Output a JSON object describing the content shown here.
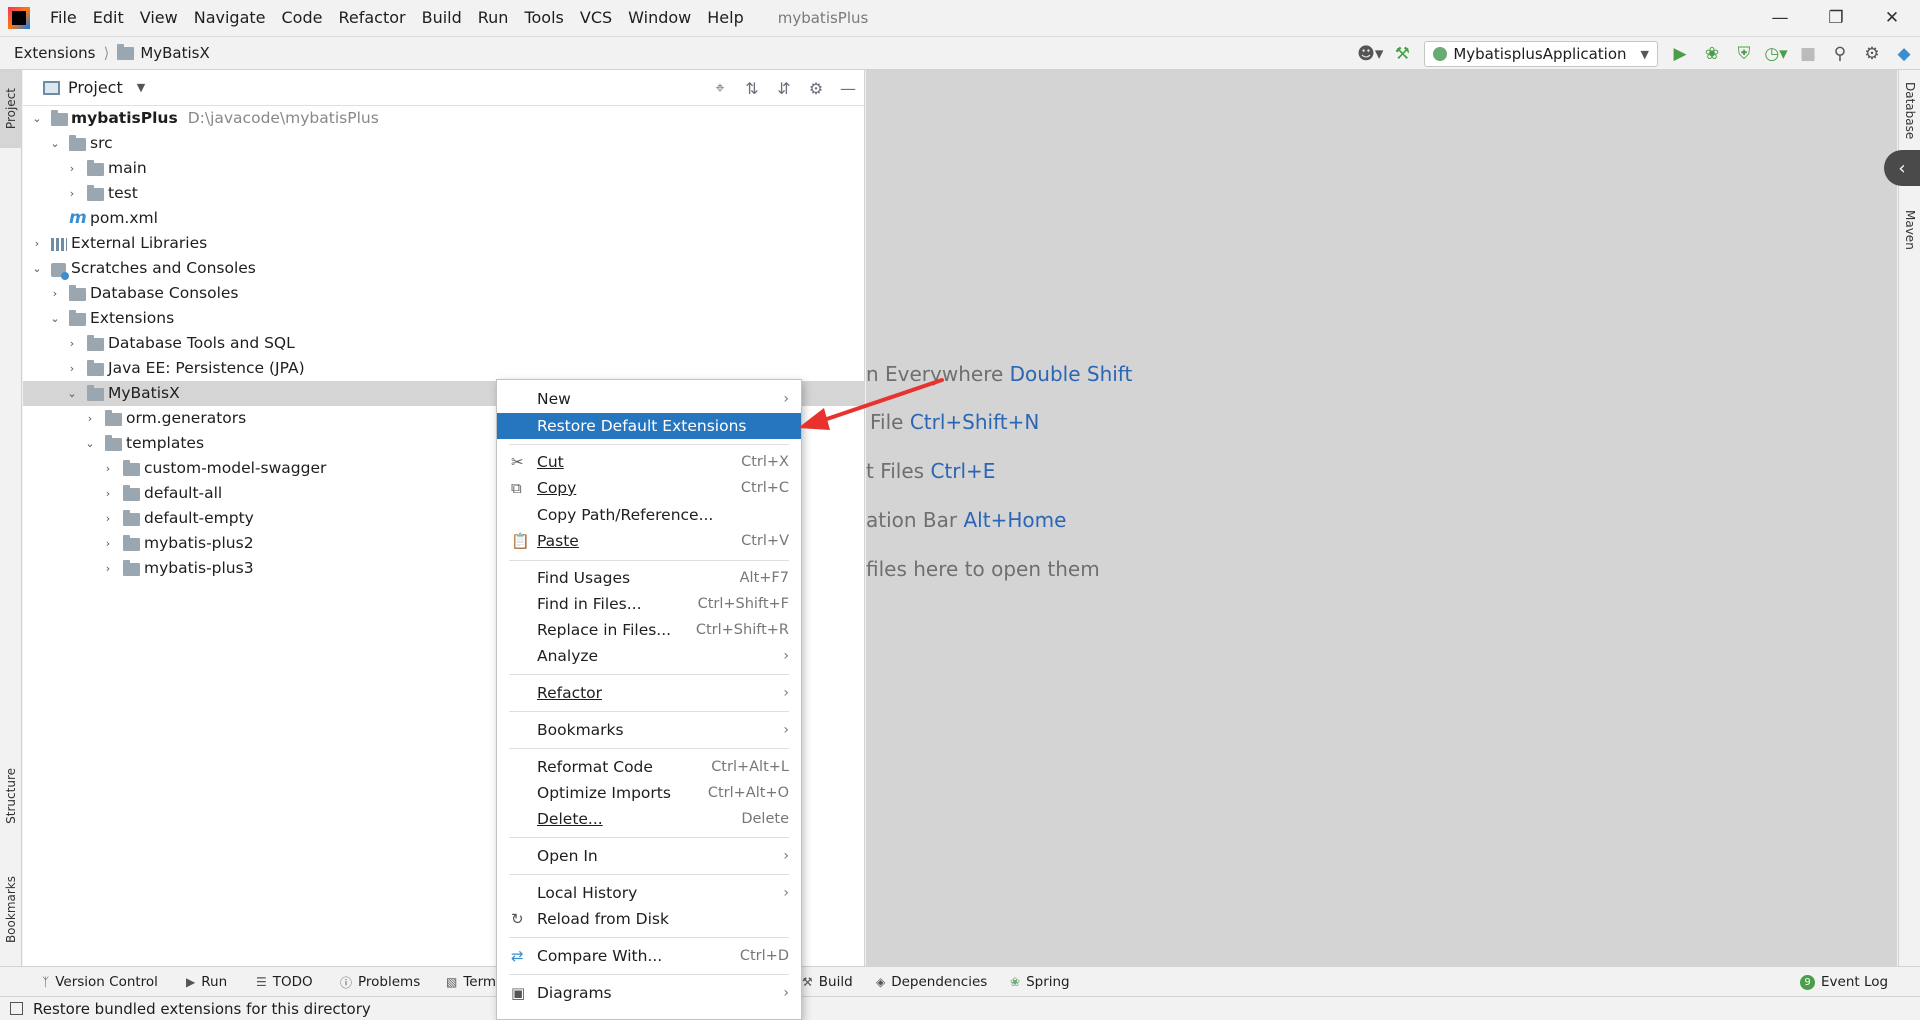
{
  "menubar": {
    "items": [
      "File",
      "Edit",
      "View",
      "Navigate",
      "Code",
      "Refactor",
      "Build",
      "Run",
      "Tools",
      "VCS",
      "Window",
      "Help"
    ],
    "project_title": "mybatisPlus"
  },
  "navbar": {
    "crumb1": "Extensions",
    "crumb2": "MyBatisX",
    "run_config": "MybatisplusApplication"
  },
  "left_stripe": {
    "project": "Project",
    "structure": "Structure",
    "bookmarks": "Bookmarks"
  },
  "right_stripe": {
    "database": "Database",
    "maven": "Maven"
  },
  "project_panel": {
    "title": "Project"
  },
  "tree": {
    "root_name": "mybatisPlus",
    "root_path": "D:\\javacode\\mybatisPlus",
    "src": "src",
    "main": "main",
    "test": "test",
    "pom": "pom.xml",
    "ext_libs": "External Libraries",
    "scratches": "Scratches and Consoles",
    "db_consoles": "Database Consoles",
    "extensions": "Extensions",
    "db_tools": "Database Tools and SQL",
    "javaee": "Java EE: Persistence (JPA)",
    "mybatisx": "MyBatisX",
    "orm": "orm.generators",
    "templates": "templates",
    "t1": "custom-model-swagger",
    "t2": "default-all",
    "t3": "default-empty",
    "t4": "mybatis-plus2",
    "t5": "mybatis-plus3"
  },
  "editor_hints": {
    "h1_text": "n Everywhere ",
    "h1_key": "Double Shift",
    "h2_text": "File ",
    "h2_key": "Ctrl+Shift+N",
    "h3_text": "t Files ",
    "h3_key": "Ctrl+E",
    "h4_text": "ation Bar ",
    "h4_key": "Alt+Home",
    "h5_text": "files here to open them"
  },
  "context_menu": {
    "new": "New",
    "restore": "Restore Default Extensions",
    "cut": "Cut",
    "cut_sc": "Ctrl+X",
    "copy": "Copy",
    "copy_sc": "Ctrl+C",
    "copy_path": "Copy Path/Reference...",
    "paste": "Paste",
    "paste_sc": "Ctrl+V",
    "find_usages": "Find Usages",
    "find_usages_sc": "Alt+F7",
    "find_in_files": "Find in Files...",
    "find_in_files_sc": "Ctrl+Shift+F",
    "replace_in_files": "Replace in Files...",
    "replace_in_files_sc": "Ctrl+Shift+R",
    "analyze": "Analyze",
    "refactor": "Refactor",
    "bookmarks": "Bookmarks",
    "reformat": "Reformat Code",
    "reformat_sc": "Ctrl+Alt+L",
    "optimize": "Optimize Imports",
    "optimize_sc": "Ctrl+Alt+O",
    "delete": "Delete...",
    "delete_sc": "Delete",
    "open_in": "Open In",
    "local_history": "Local History",
    "reload": "Reload from Disk",
    "compare": "Compare With...",
    "compare_sc": "Ctrl+D",
    "diagrams": "Diagrams"
  },
  "bottombar": {
    "version_control": "Version Control",
    "run": "Run",
    "todo": "TODO",
    "problems": "Problems",
    "terminal": "Term",
    "build": "Build",
    "dependencies": "Dependencies",
    "spring": "Spring",
    "event_log": "Event Log",
    "event_count": "9"
  },
  "statusbar": {
    "text": "Restore bundled extensions for this directory"
  },
  "colors": {
    "highlight": "#2675bf",
    "hint_key": "#2b65b5",
    "arrow": "#e8322e"
  }
}
